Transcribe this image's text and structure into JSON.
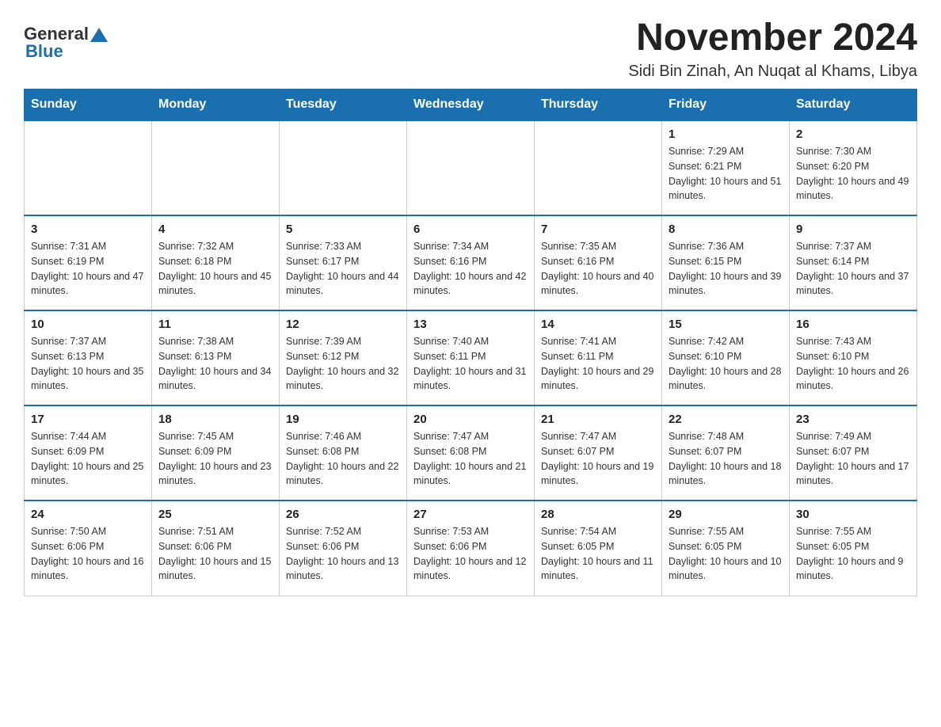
{
  "header": {
    "logo_general": "General",
    "logo_blue": "Blue",
    "month_title": "November 2024",
    "location": "Sidi Bin Zinah, An Nuqat al Khams, Libya"
  },
  "weekdays": [
    "Sunday",
    "Monday",
    "Tuesday",
    "Wednesday",
    "Thursday",
    "Friday",
    "Saturday"
  ],
  "weeks": [
    [
      {
        "day": "",
        "info": ""
      },
      {
        "day": "",
        "info": ""
      },
      {
        "day": "",
        "info": ""
      },
      {
        "day": "",
        "info": ""
      },
      {
        "day": "",
        "info": ""
      },
      {
        "day": "1",
        "info": "Sunrise: 7:29 AM\nSunset: 6:21 PM\nDaylight: 10 hours and 51 minutes."
      },
      {
        "day": "2",
        "info": "Sunrise: 7:30 AM\nSunset: 6:20 PM\nDaylight: 10 hours and 49 minutes."
      }
    ],
    [
      {
        "day": "3",
        "info": "Sunrise: 7:31 AM\nSunset: 6:19 PM\nDaylight: 10 hours and 47 minutes."
      },
      {
        "day": "4",
        "info": "Sunrise: 7:32 AM\nSunset: 6:18 PM\nDaylight: 10 hours and 45 minutes."
      },
      {
        "day": "5",
        "info": "Sunrise: 7:33 AM\nSunset: 6:17 PM\nDaylight: 10 hours and 44 minutes."
      },
      {
        "day": "6",
        "info": "Sunrise: 7:34 AM\nSunset: 6:16 PM\nDaylight: 10 hours and 42 minutes."
      },
      {
        "day": "7",
        "info": "Sunrise: 7:35 AM\nSunset: 6:16 PM\nDaylight: 10 hours and 40 minutes."
      },
      {
        "day": "8",
        "info": "Sunrise: 7:36 AM\nSunset: 6:15 PM\nDaylight: 10 hours and 39 minutes."
      },
      {
        "day": "9",
        "info": "Sunrise: 7:37 AM\nSunset: 6:14 PM\nDaylight: 10 hours and 37 minutes."
      }
    ],
    [
      {
        "day": "10",
        "info": "Sunrise: 7:37 AM\nSunset: 6:13 PM\nDaylight: 10 hours and 35 minutes."
      },
      {
        "day": "11",
        "info": "Sunrise: 7:38 AM\nSunset: 6:13 PM\nDaylight: 10 hours and 34 minutes."
      },
      {
        "day": "12",
        "info": "Sunrise: 7:39 AM\nSunset: 6:12 PM\nDaylight: 10 hours and 32 minutes."
      },
      {
        "day": "13",
        "info": "Sunrise: 7:40 AM\nSunset: 6:11 PM\nDaylight: 10 hours and 31 minutes."
      },
      {
        "day": "14",
        "info": "Sunrise: 7:41 AM\nSunset: 6:11 PM\nDaylight: 10 hours and 29 minutes."
      },
      {
        "day": "15",
        "info": "Sunrise: 7:42 AM\nSunset: 6:10 PM\nDaylight: 10 hours and 28 minutes."
      },
      {
        "day": "16",
        "info": "Sunrise: 7:43 AM\nSunset: 6:10 PM\nDaylight: 10 hours and 26 minutes."
      }
    ],
    [
      {
        "day": "17",
        "info": "Sunrise: 7:44 AM\nSunset: 6:09 PM\nDaylight: 10 hours and 25 minutes."
      },
      {
        "day": "18",
        "info": "Sunrise: 7:45 AM\nSunset: 6:09 PM\nDaylight: 10 hours and 23 minutes."
      },
      {
        "day": "19",
        "info": "Sunrise: 7:46 AM\nSunset: 6:08 PM\nDaylight: 10 hours and 22 minutes."
      },
      {
        "day": "20",
        "info": "Sunrise: 7:47 AM\nSunset: 6:08 PM\nDaylight: 10 hours and 21 minutes."
      },
      {
        "day": "21",
        "info": "Sunrise: 7:47 AM\nSunset: 6:07 PM\nDaylight: 10 hours and 19 minutes."
      },
      {
        "day": "22",
        "info": "Sunrise: 7:48 AM\nSunset: 6:07 PM\nDaylight: 10 hours and 18 minutes."
      },
      {
        "day": "23",
        "info": "Sunrise: 7:49 AM\nSunset: 6:07 PM\nDaylight: 10 hours and 17 minutes."
      }
    ],
    [
      {
        "day": "24",
        "info": "Sunrise: 7:50 AM\nSunset: 6:06 PM\nDaylight: 10 hours and 16 minutes."
      },
      {
        "day": "25",
        "info": "Sunrise: 7:51 AM\nSunset: 6:06 PM\nDaylight: 10 hours and 15 minutes."
      },
      {
        "day": "26",
        "info": "Sunrise: 7:52 AM\nSunset: 6:06 PM\nDaylight: 10 hours and 13 minutes."
      },
      {
        "day": "27",
        "info": "Sunrise: 7:53 AM\nSunset: 6:06 PM\nDaylight: 10 hours and 12 minutes."
      },
      {
        "day": "28",
        "info": "Sunrise: 7:54 AM\nSunset: 6:05 PM\nDaylight: 10 hours and 11 minutes."
      },
      {
        "day": "29",
        "info": "Sunrise: 7:55 AM\nSunset: 6:05 PM\nDaylight: 10 hours and 10 minutes."
      },
      {
        "day": "30",
        "info": "Sunrise: 7:55 AM\nSunset: 6:05 PM\nDaylight: 10 hours and 9 minutes."
      }
    ]
  ]
}
